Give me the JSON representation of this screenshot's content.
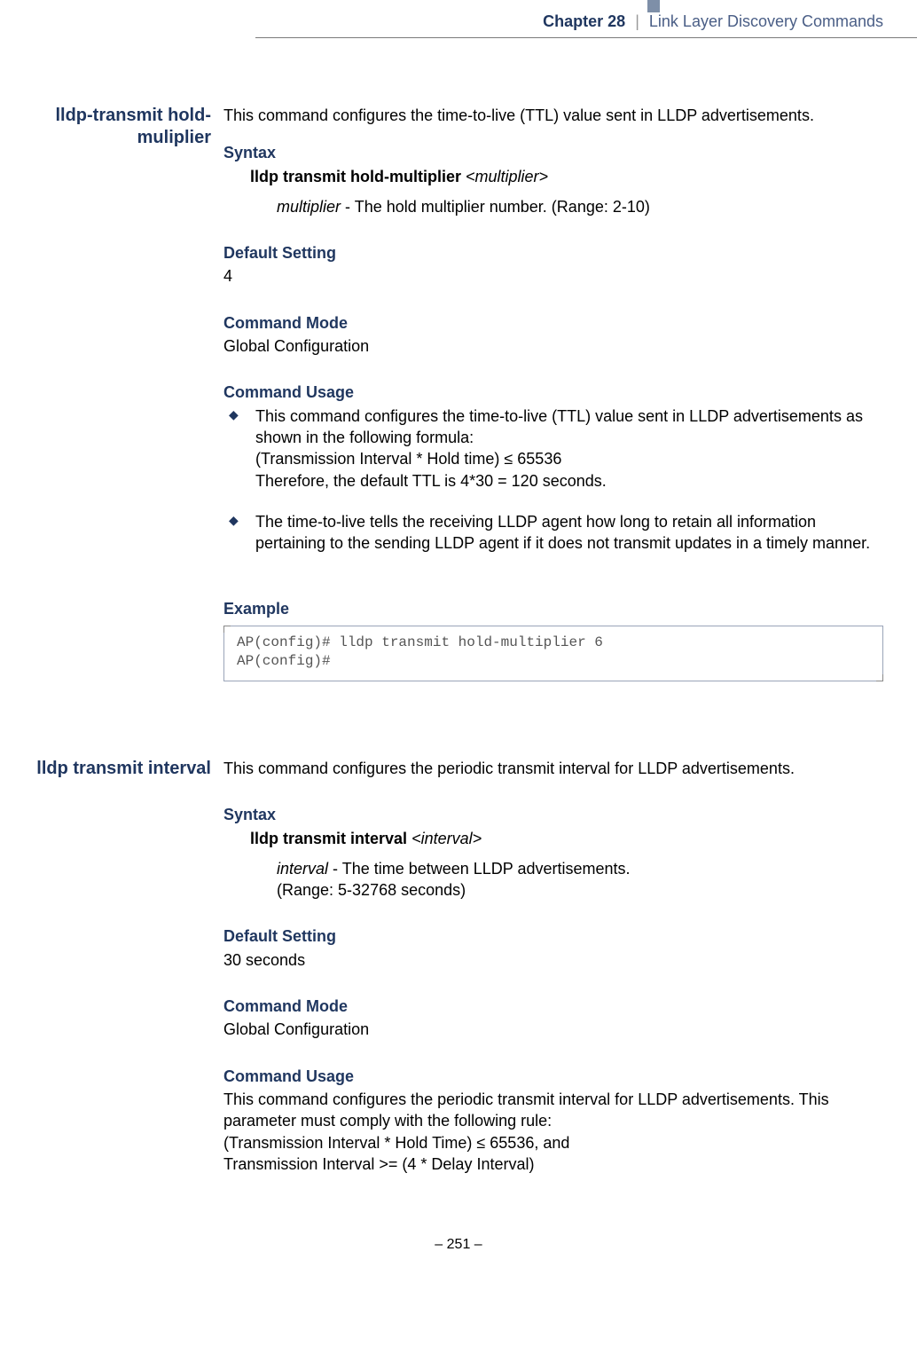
{
  "header": {
    "chapter_strong": "Chapter 28",
    "separator": "|",
    "chapter_title": "Link Layer Discovery Commands"
  },
  "sections": [
    {
      "cmd_name": "lldp-transmit hold-muliplier",
      "intro": "This command configures the time-to-live (TTL) value sent in LLDP advertisements.",
      "syntax_head": "Syntax",
      "syntax_bold": "lldp transmit hold-multiplier",
      "syntax_arg": "<multiplier>",
      "param_name": "multiplier",
      "param_desc": " - The hold multiplier number. (Range: 2-10)",
      "default_head": "Default Setting",
      "default_val": "4",
      "mode_head": "Command Mode",
      "mode_val": "Global Configuration",
      "usage_head": "Command Usage",
      "usage_bullets": [
        "This command configures the time-to-live (TTL) value sent in LLDP advertisements as shown in the following formula:\n(Transmission Interval * Hold time) ≤ 65536\nTherefore, the default TTL is 4*30 = 120 seconds.",
        "The time-to-live tells the receiving LLDP agent how long to retain all information pertaining to the sending LLDP agent if it does not transmit updates in a timely manner."
      ],
      "example_head": "Example",
      "example_code": "AP(config)# lldp transmit hold-multiplier 6\nAP(config)#"
    },
    {
      "cmd_name": "lldp transmit interval",
      "intro": "This command configures the periodic transmit interval for LLDP advertisements.",
      "syntax_head": "Syntax",
      "syntax_bold": "lldp transmit interval",
      "syntax_arg": "<interval>",
      "param_name": "interval",
      "param_desc": " - The time between LLDP advertisements.",
      "param_desc2": "(Range: 5-32768 seconds)",
      "default_head": "Default Setting",
      "default_val": "30 seconds",
      "mode_head": "Command Mode",
      "mode_val": "Global Configuration",
      "usage_head": "Command Usage",
      "usage_text": "This command configures the periodic transmit interval for LLDP advertisements. This parameter must comply with the following rule:\n(Transmission Interval * Hold Time) ≤ 65536, and\nTransmission Interval >= (4 * Delay Interval)"
    }
  ],
  "footer": {
    "page_num": "–  251  –"
  }
}
